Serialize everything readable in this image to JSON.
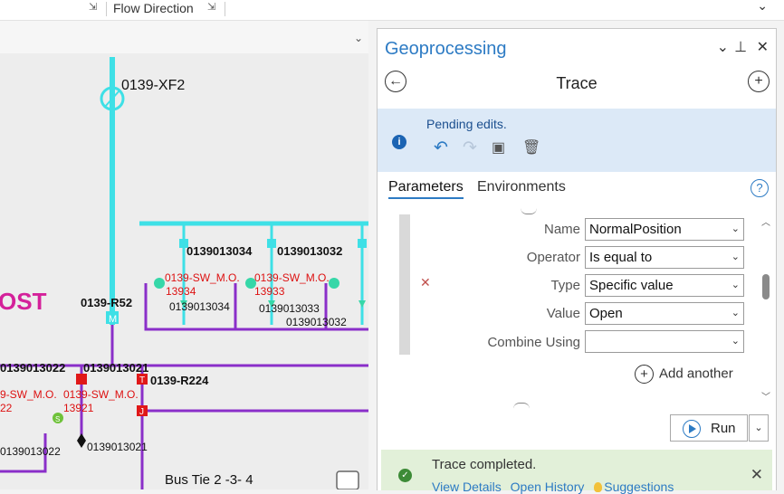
{
  "ribbon": {
    "label": "Flow Direction"
  },
  "map": {
    "device_labels": [
      "0139-XF2",
      "0139013034",
      "0139013032",
      "0139-R52",
      "0139013022",
      "0139013021",
      "0139-R224"
    ],
    "switch_labels_red": [
      "0139-SW_M.O.",
      "13934",
      "0139-SW_M.O.",
      "13933",
      "9-SW_M.O.",
      "22",
      "0139-SW_M.O.",
      "13921"
    ],
    "node_labels": [
      "0139013034",
      "0139013033",
      "0139013032",
      "0139013022",
      "0139013021"
    ],
    "substation_label": "OST",
    "bus_label": "Bus Tie 2 -3- 4",
    "marker_letters": {
      "m": "M",
      "t": "T",
      "j": "J",
      "s": "S"
    },
    "colors": {
      "trace": "#3ee0e6",
      "line": "#8a2fc9",
      "switch": "#e01818",
      "substation": "#d4219a"
    }
  },
  "panel": {
    "title": "Geoprocessing",
    "tool": "Trace",
    "pending": {
      "text": "Pending edits."
    },
    "tabs": [
      "Parameters",
      "Environments"
    ],
    "params": [
      {
        "label": "Name",
        "value": "NormalPosition"
      },
      {
        "label": "Operator",
        "value": "Is equal to"
      },
      {
        "label": "Type",
        "value": "Specific value"
      },
      {
        "label": "Value",
        "value": "Open"
      },
      {
        "label": "Combine Using",
        "value": ""
      }
    ],
    "add_another": "Add another",
    "run": "Run",
    "status": {
      "text": "Trace completed.",
      "links": [
        "View Details",
        "Open History",
        "Suggestions"
      ]
    }
  }
}
